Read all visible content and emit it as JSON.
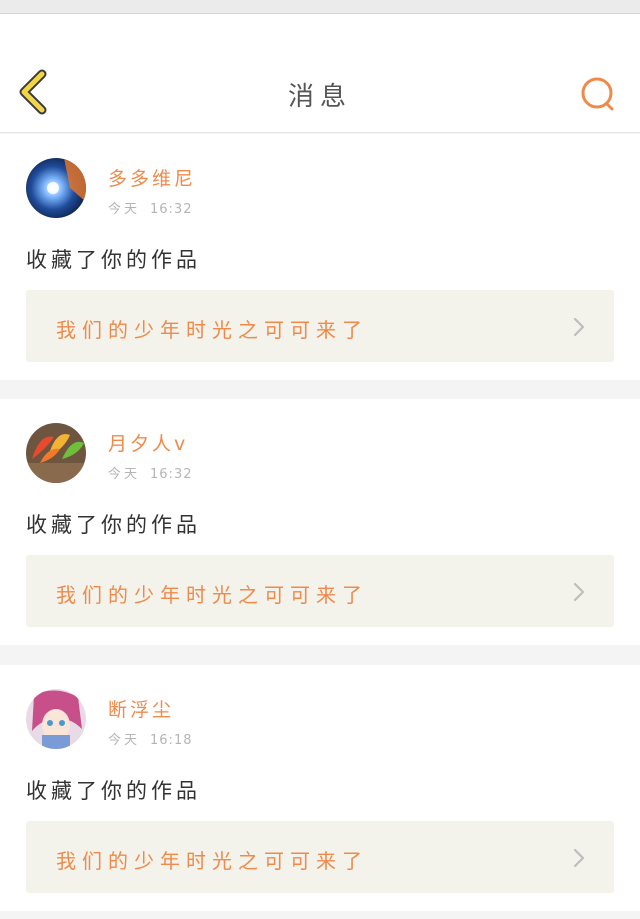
{
  "header": {
    "title": "消息",
    "back_icon": "chevron-left-icon",
    "search_icon": "search-icon",
    "accent_back": "#f2d544",
    "accent_search": "#f08a4b"
  },
  "messages": [
    {
      "user": "多多维尼",
      "time_label": "今天",
      "time": "16:32",
      "action": "收藏了你的作品",
      "work_title": "我们的少年时光之可可来了"
    },
    {
      "user": "月夕人v",
      "time_label": "今天",
      "time": "16:32",
      "action": "收藏了你的作品",
      "work_title": "我们的少年时光之可可来了"
    },
    {
      "user": "断浮尘",
      "time_label": "今天",
      "time": "16:18",
      "action": "收藏了你的作品",
      "work_title": "我们的少年时光之可可来了"
    }
  ],
  "colors": {
    "name": "#f08a4b",
    "link_bg": "#f3f3ec",
    "page_bg": "#f4f4f4"
  }
}
